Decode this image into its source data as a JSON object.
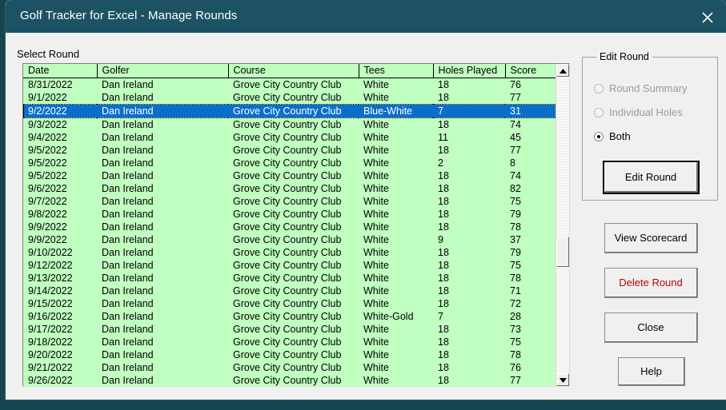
{
  "window": {
    "title": "Golf Tracker for Excel - Manage Rounds",
    "close_icon": "close-icon"
  },
  "main": {
    "select_round_label": "Select Round"
  },
  "grid": {
    "columns": [
      "Date",
      "Golfer",
      "Course",
      "Tees",
      "Holes Played",
      "Score"
    ],
    "selected_index": 2,
    "rows": [
      [
        "8/31/2022",
        "Dan Ireland",
        "Grove City Country Club",
        "White",
        "18",
        "76"
      ],
      [
        "9/1/2022",
        "Dan Ireland",
        "Grove City Country Club",
        "White",
        "18",
        "77"
      ],
      [
        "9/2/2022",
        "Dan Ireland",
        "Grove City Country Club",
        "Blue-White",
        "7",
        "31"
      ],
      [
        "9/3/2022",
        "Dan Ireland",
        "Grove City Country Club",
        "White",
        "18",
        "74"
      ],
      [
        "9/4/2022",
        "Dan Ireland",
        "Grove City Country Club",
        "White",
        "11",
        "45"
      ],
      [
        "9/5/2022",
        "Dan Ireland",
        "Grove City Country Club",
        "White",
        "18",
        "77"
      ],
      [
        "9/5/2022",
        "Dan Ireland",
        "Grove City Country Club",
        "White",
        "2",
        "8"
      ],
      [
        "9/5/2022",
        "Dan Ireland",
        "Grove City Country Club",
        "White",
        "18",
        "74"
      ],
      [
        "9/6/2022",
        "Dan Ireland",
        "Grove City Country Club",
        "White",
        "18",
        "82"
      ],
      [
        "9/7/2022",
        "Dan Ireland",
        "Grove City Country Club",
        "White",
        "18",
        "75"
      ],
      [
        "9/8/2022",
        "Dan Ireland",
        "Grove City Country Club",
        "White",
        "18",
        "79"
      ],
      [
        "9/9/2022",
        "Dan Ireland",
        "Grove City Country Club",
        "White",
        "18",
        "78"
      ],
      [
        "9/9/2022",
        "Dan Ireland",
        "Grove City Country Club",
        "White",
        "9",
        "37"
      ],
      [
        "9/10/2022",
        "Dan Ireland",
        "Grove City Country Club",
        "White",
        "18",
        "79"
      ],
      [
        "9/12/2022",
        "Dan Ireland",
        "Grove City Country Club",
        "White",
        "18",
        "75"
      ],
      [
        "9/13/2022",
        "Dan Ireland",
        "Grove City Country Club",
        "White",
        "18",
        "78"
      ],
      [
        "9/14/2022",
        "Dan Ireland",
        "Grove City Country Club",
        "White",
        "18",
        "71"
      ],
      [
        "9/15/2022",
        "Dan Ireland",
        "Grove City Country Club",
        "White",
        "18",
        "72"
      ],
      [
        "9/16/2022",
        "Dan Ireland",
        "Grove City Country Club",
        "White-Gold",
        "7",
        "28"
      ],
      [
        "9/17/2022",
        "Dan Ireland",
        "Grove City Country Club",
        "White",
        "18",
        "73"
      ],
      [
        "9/18/2022",
        "Dan Ireland",
        "Grove City Country Club",
        "White",
        "18",
        "75"
      ],
      [
        "9/20/2022",
        "Dan Ireland",
        "Grove City Country Club",
        "White",
        "18",
        "78"
      ],
      [
        "9/21/2022",
        "Dan Ireland",
        "Grove City Country Club",
        "White",
        "18",
        "76"
      ],
      [
        "9/26/2022",
        "Dan Ireland",
        "Grove City Country Club",
        "White",
        "18",
        "77"
      ]
    ]
  },
  "edit_round_group": {
    "title": "Edit Round",
    "options": [
      {
        "label": "Round Summary",
        "checked": false,
        "disabled": true
      },
      {
        "label": "Individual Holes",
        "checked": false,
        "disabled": true
      },
      {
        "label": "Both",
        "checked": true,
        "disabled": false
      }
    ],
    "edit_button": "Edit Round"
  },
  "actions": {
    "view_scorecard": "View Scorecard",
    "delete_round": "Delete Round",
    "close": "Close",
    "help": "Help"
  },
  "colors": {
    "titlebar": "#1d5265",
    "grid_row": "#c0ffc0",
    "selection": "#0c6ecb",
    "delete_text": "#c00000",
    "dialog_face": "#f0f0f0"
  }
}
